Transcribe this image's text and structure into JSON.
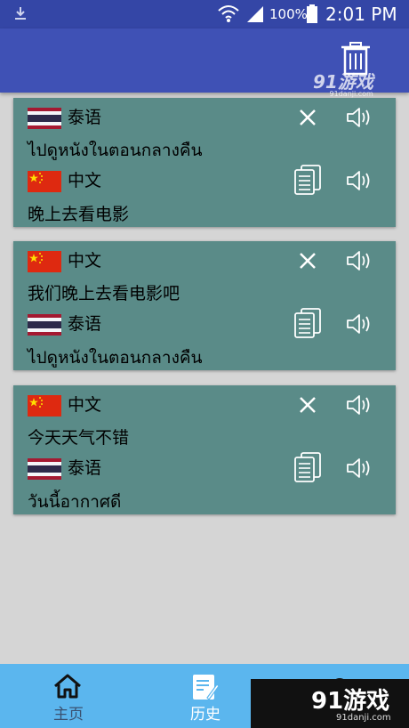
{
  "status_bar": {
    "battery": "100%",
    "time": "2:01 PM"
  },
  "watermark": {
    "brand": "91游戏",
    "site": "91danji.com"
  },
  "cards": [
    {
      "source": {
        "lang": "泰语",
        "flag": "thailand-flag",
        "text": "ไปดูหนังในตอนกลางคืน"
      },
      "target": {
        "lang": "中文",
        "flag": "china-flag",
        "text": "晚上去看电影"
      }
    },
    {
      "source": {
        "lang": "中文",
        "flag": "china-flag",
        "text": "我们晚上去看电影吧"
      },
      "target": {
        "lang": "泰语",
        "flag": "thailand-flag",
        "text": "ไปดูหนังในตอนกลางคืน"
      }
    },
    {
      "source": {
        "lang": "中文",
        "flag": "china-flag",
        "text": "今天天气不错"
      },
      "target": {
        "lang": "泰语",
        "flag": "thailand-flag",
        "text": "วันนี้อากาศดี"
      }
    }
  ],
  "bottom_nav": {
    "home": "主页",
    "history": "历史"
  },
  "colors": {
    "status_bar": "#3446a6",
    "app_bar": "#3f51b5",
    "card": "#5a8b88",
    "bottom_bar": "#5bb6ee",
    "background": "#d5d5d5"
  }
}
